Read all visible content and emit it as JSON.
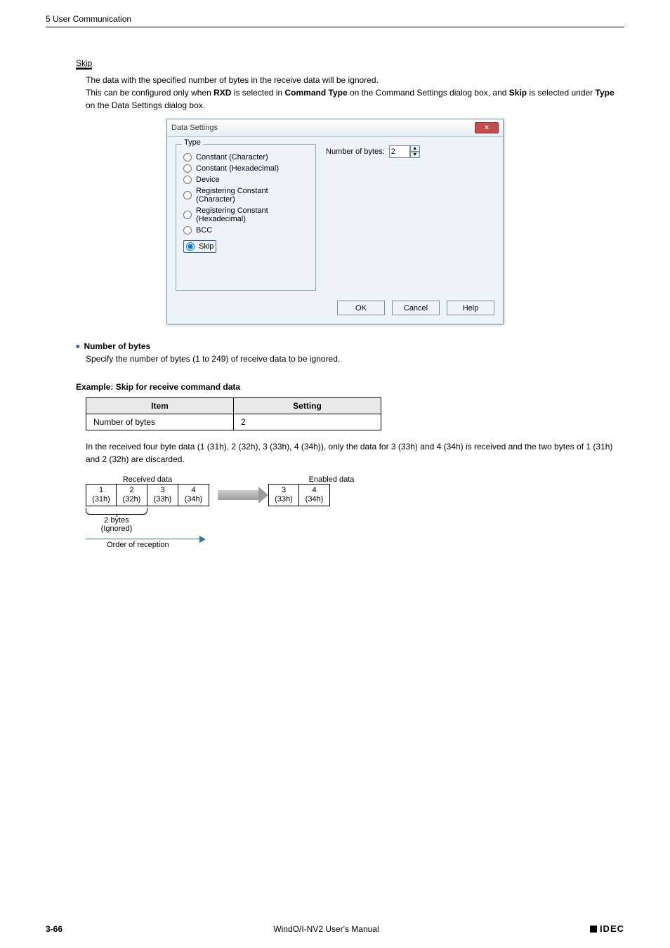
{
  "header": {
    "section": "5 User Communication"
  },
  "skip": {
    "title": "Skip",
    "desc1": "The data with the specified number of bytes in the receive data will be ignored.",
    "desc2_a": "This can be configured only when ",
    "desc2_b": " is selected in ",
    "desc2_c": " on the Command Settings dialog box, and ",
    "desc2_d": " is selected under ",
    "desc2_e": " on the Data Settings dialog box.",
    "rxd": "RXD",
    "cmdtype": "Command Type",
    "skipword": "Skip",
    "typeword": "Type"
  },
  "dialog": {
    "title": "Data Settings",
    "close": "×",
    "group_legend": "Type",
    "radios": {
      "r0": "Constant (Character)",
      "r1": "Constant (Hexadecimal)",
      "r2": "Device",
      "r3": "Registering Constant (Character)",
      "r4": "Registering Constant (Hexadecimal)",
      "r5": "BCC",
      "r6": "Skip"
    },
    "nb_label": "Number of bytes:",
    "nb_value": "2",
    "buttons": {
      "ok": "OK",
      "cancel": "Cancel",
      "help": "Help"
    }
  },
  "numbytes": {
    "heading": "Number of bytes",
    "text": "Specify the number of bytes (1 to 249) of receive data to be ignored."
  },
  "example": {
    "title": "Example: Skip for receive command data",
    "th_item": "Item",
    "th_setting": "Setting",
    "row_item": "Number of bytes",
    "row_setting": "2",
    "explain": "In the received four byte data (1 (31h), 2 (32h), 3 (33h), 4 (34h)), only the data for 3 (33h) and 4 (34h) is received and the two bytes of 1 (31h) and 2 (32h) are discarded."
  },
  "diagram": {
    "recv_label": "Received data",
    "enab_label": "Enabled data",
    "cells_recv": {
      "c0t": "1",
      "c0b": "(31h)",
      "c1t": "2",
      "c1b": "(32h)",
      "c2t": "3",
      "c2b": "(33h)",
      "c3t": "4",
      "c3b": "(34h)"
    },
    "cells_enab": {
      "c0t": "3",
      "c0b": "(33h)",
      "c1t": "4",
      "c1b": "(34h)"
    },
    "ignored_a": "2 bytes",
    "ignored_b": "(Ignored)",
    "order": "Order of reception"
  },
  "footer": {
    "page": "3-66",
    "center": "WindO/I-NV2 User's Manual",
    "brand": "IDEC"
  }
}
